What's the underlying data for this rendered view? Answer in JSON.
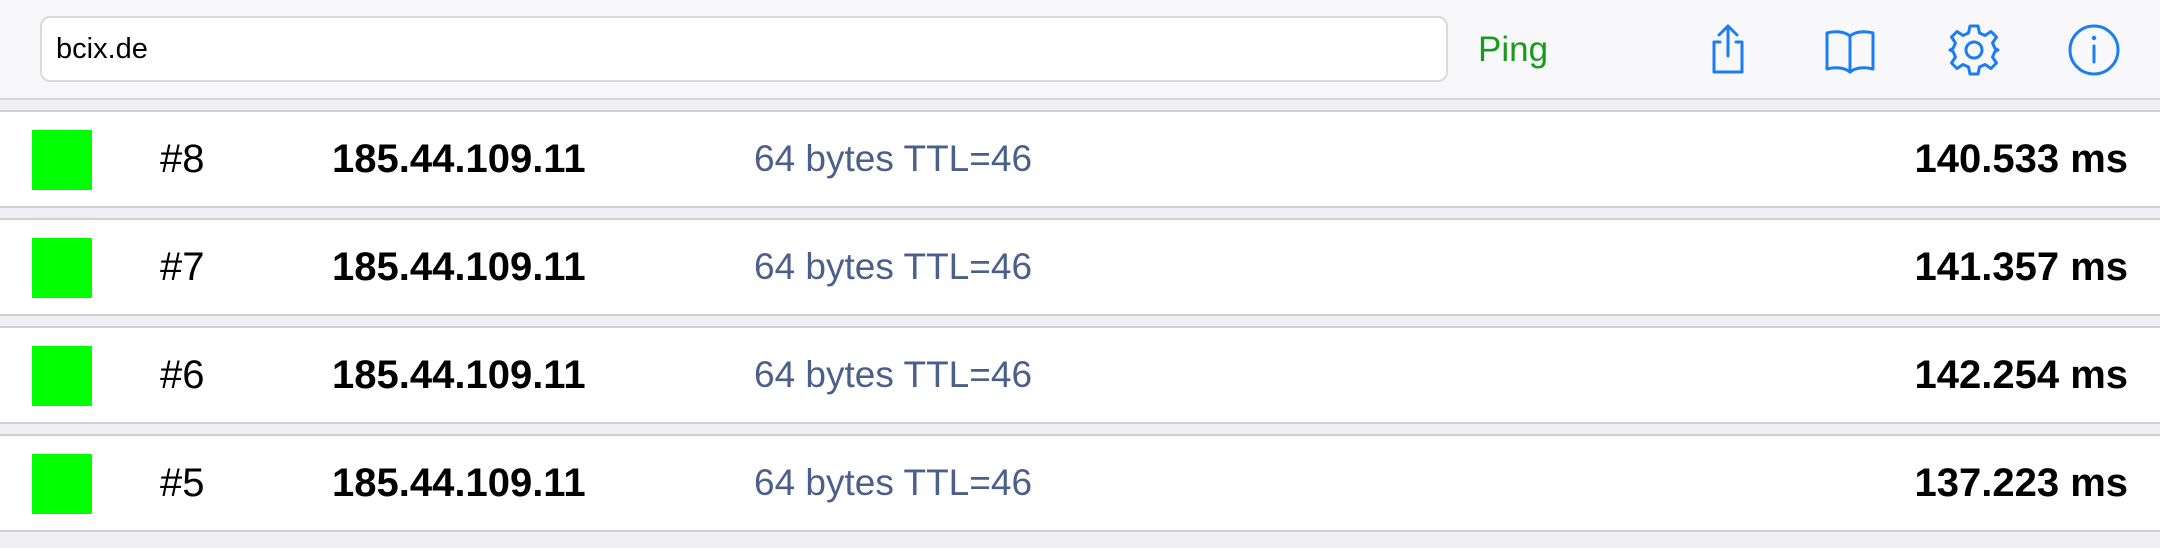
{
  "toolbar": {
    "host_value": "bcix.de",
    "ping_label": "Ping",
    "icons": [
      "share-icon",
      "bookmarks-icon",
      "settings-icon",
      "info-icon"
    ],
    "accent_color": "#1a7ef2",
    "ping_color": "#1a9a1a"
  },
  "results": [
    {
      "seq": "#8",
      "ip": "185.44.109.11",
      "info": "64 bytes TTL=46",
      "time": "140.533 ms",
      "status": "success",
      "status_color": "#00ff00"
    },
    {
      "seq": "#7",
      "ip": "185.44.109.11",
      "info": "64 bytes TTL=46",
      "time": "141.357 ms",
      "status": "success",
      "status_color": "#00ff00"
    },
    {
      "seq": "#6",
      "ip": "185.44.109.11",
      "info": "64 bytes TTL=46",
      "time": "142.254 ms",
      "status": "success",
      "status_color": "#00ff00"
    },
    {
      "seq": "#5",
      "ip": "185.44.109.11",
      "info": "64 bytes TTL=46",
      "time": "137.223 ms",
      "status": "success",
      "status_color": "#00ff00"
    }
  ]
}
